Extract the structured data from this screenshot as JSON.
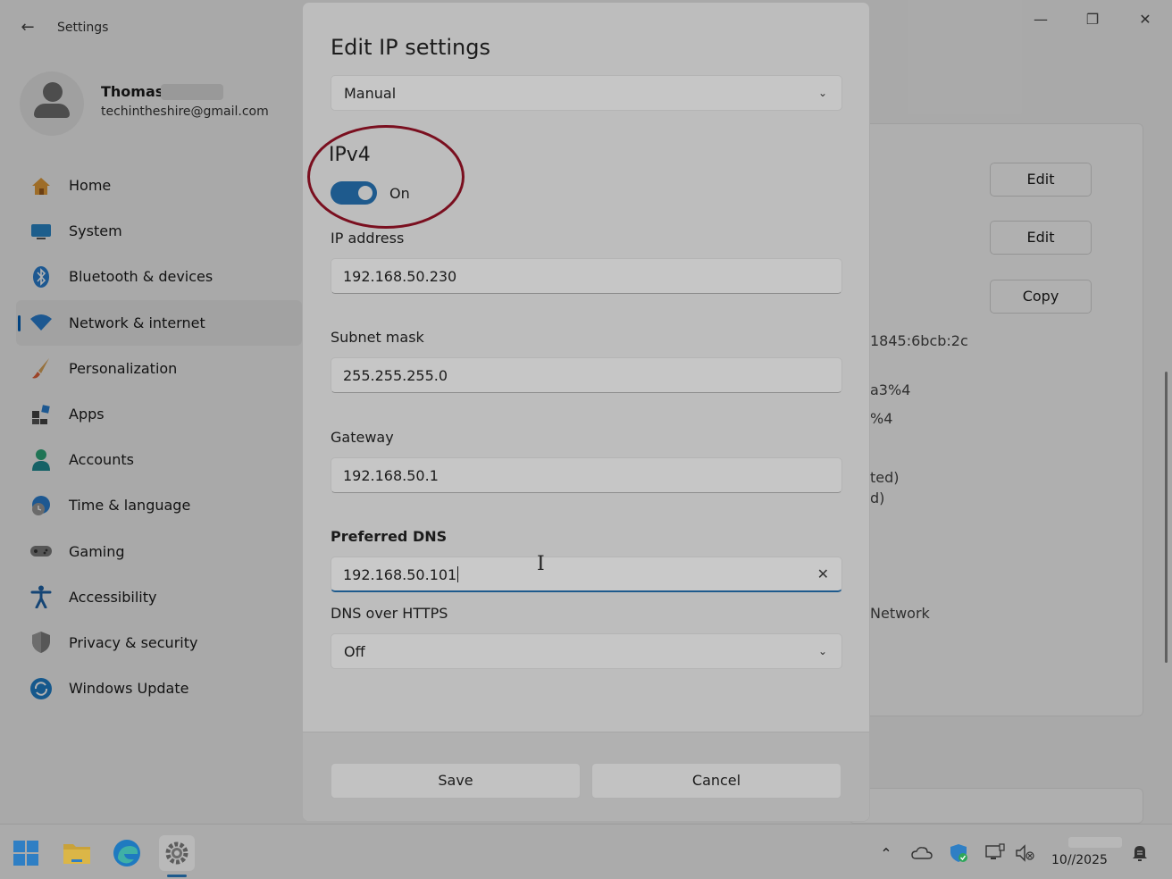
{
  "window": {
    "title": "Settings",
    "back_icon": "←",
    "minimize_icon": "—",
    "maximize_icon": "❐",
    "close_icon": "✕"
  },
  "profile": {
    "name": "Thomas",
    "email": "techintheshire@gmail.com"
  },
  "sidebar": {
    "items": [
      {
        "label": "Home",
        "icon": "home-icon"
      },
      {
        "label": "System",
        "icon": "system-icon"
      },
      {
        "label": "Bluetooth & devices",
        "icon": "bluetooth-icon"
      },
      {
        "label": "Network & internet",
        "icon": "wifi-icon",
        "active": true
      },
      {
        "label": "Personalization",
        "icon": "brush-icon"
      },
      {
        "label": "Apps",
        "icon": "apps-icon"
      },
      {
        "label": "Accounts",
        "icon": "accounts-icon"
      },
      {
        "label": "Time & language",
        "icon": "clock-globe-icon"
      },
      {
        "label": "Gaming",
        "icon": "gamepad-icon"
      },
      {
        "label": "Accessibility",
        "icon": "accessibility-icon"
      },
      {
        "label": "Privacy & security",
        "icon": "shield-icon"
      },
      {
        "label": "Windows Update",
        "icon": "update-icon"
      }
    ]
  },
  "background_content": {
    "buttons": [
      "Edit",
      "Edit",
      "Copy"
    ],
    "texts": [
      "1845:6bcb:2c",
      "a3%4",
      "%4",
      "ted)",
      "d)",
      "Network"
    ]
  },
  "dialog": {
    "title": "Edit IP settings",
    "mode_value": "Manual",
    "ipv4": {
      "section_title": "IPv4",
      "toggle_state": "On",
      "toggle_on": true
    },
    "fields": {
      "ip_address": {
        "label": "IP address",
        "value": "192.168.50.230"
      },
      "subnet_mask": {
        "label": "Subnet mask",
        "value": "255.255.255.0"
      },
      "gateway": {
        "label": "Gateway",
        "value": "192.168.50.1"
      },
      "preferred_dns": {
        "label": "Preferred DNS",
        "value": "192.168.50.101"
      }
    },
    "dns_over_https": {
      "label": "DNS over HTTPS",
      "value": "Off"
    },
    "clear_icon": "✕",
    "chevron": "⌄",
    "save_label": "Save",
    "cancel_label": "Cancel"
  },
  "taskbar": {
    "apps": [
      "start-icon",
      "file-explorer-icon",
      "edge-icon",
      "settings-icon"
    ],
    "tray": {
      "chevron": "⌃",
      "date": "10/‌‌/2025"
    }
  },
  "colors": {
    "accent": "#1e5a8d",
    "annotation": "#7a0f1f",
    "overlay": "rgba(0,0,0,0.30)"
  }
}
